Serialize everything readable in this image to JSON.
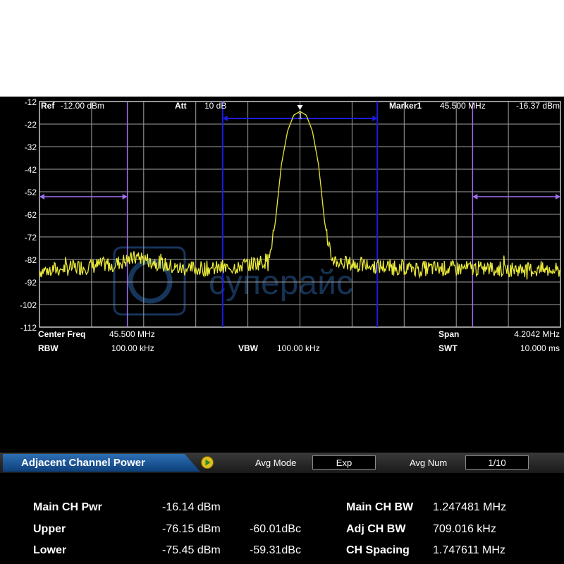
{
  "header": {
    "ref_label": "Ref",
    "ref_value": "-12.00 dBm",
    "att_label": "Att",
    "att_value": "10 dB",
    "marker_label": "Marker1",
    "marker_freq": "45.500 MHz",
    "marker_level": "-16.37 dBm",
    "marker_number": "1"
  },
  "footer": {
    "center_label": "Center Freq",
    "center_value": "45.500 MHz",
    "rbw_label": "RBW",
    "rbw_value": "100.00 kHz",
    "vbw_label": "VBW",
    "vbw_value": "100.00 kHz",
    "span_label": "Span",
    "span_value": "4.2042 MHz",
    "swt_label": "SWT",
    "swt_value": "10.000 ms"
  },
  "menu": {
    "mode_title": "Adjacent Channel Power",
    "avg_mode_label": "Avg Mode",
    "avg_mode_value": "Exp",
    "avg_num_label": "Avg Num",
    "avg_num_value": "1/10"
  },
  "results": {
    "main_pwr_label": "Main CH Pwr",
    "main_pwr_value": "-16.14 dBm",
    "upper_label": "Upper",
    "upper_value": "-76.15 dBm",
    "upper_dbc": "-60.01dBc",
    "lower_label": "Lower",
    "lower_value": "-75.45 dBm",
    "lower_dbc": "-59.31dBc",
    "main_bw_label": "Main CH BW",
    "main_bw_value": "1.247481 MHz",
    "adj_bw_label": "Adj CH BW",
    "adj_bw_value": "709.016 kHz",
    "spacing_label": "CH Spacing",
    "spacing_value": "1.747611 MHz"
  },
  "watermark": "суперайс",
  "colors": {
    "trace": "#e8e83a",
    "grid": "#a0a0a0",
    "channel_lines": "#1c1ce0",
    "adjacent_markers": "#a070f0",
    "menu_accent": "#1d5aa0"
  },
  "chart_data": {
    "type": "line",
    "ylim": [
      -112,
      -12
    ],
    "yticks": [
      -12,
      -22,
      -32,
      -42,
      -52,
      -62,
      -72,
      -82,
      -92,
      -102,
      -112
    ],
    "xlim_mhz": [
      43.3979,
      47.6021
    ],
    "series": [
      {
        "x_mhz": [
          43.398,
          44.0,
          44.2,
          44.5,
          44.9,
          45.1,
          45.2,
          45.25,
          45.3,
          45.35,
          45.4,
          45.45,
          45.5,
          45.55,
          45.6,
          45.65,
          45.7,
          45.75,
          45.8,
          45.9,
          46.1,
          46.5,
          47.0,
          47.602
        ],
        "dbm": [
          -87,
          -84,
          -81,
          -86,
          -86,
          -84,
          -83,
          -82,
          -66,
          -40,
          -25,
          -18,
          -16.4,
          -18,
          -25,
          -40,
          -66,
          -81,
          -83,
          -84,
          -85,
          -86,
          -86,
          -87
        ]
      }
    ],
    "main_channel_mhz": [
      44.876,
      46.124
    ],
    "adjacent_channels_mhz": [
      [
        43.398,
        44.107
      ],
      [
        46.893,
        47.602
      ]
    ],
    "marker": {
      "x_mhz": 45.5,
      "dbm": -16.37
    }
  }
}
